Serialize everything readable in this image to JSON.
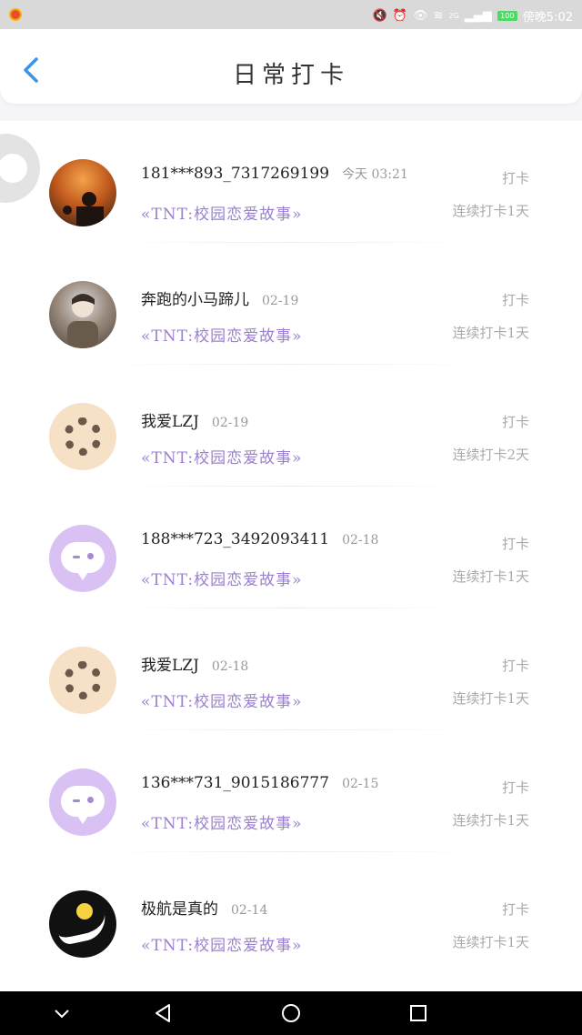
{
  "status_bar": {
    "time": "傍晚5:02",
    "network": "2G",
    "battery": "100"
  },
  "header": {
    "title": "日常打卡"
  },
  "list": {
    "items": [
      {
        "name": "181***893_7317269199",
        "date": "今天 03:21",
        "story": "«TNT:校园恋爱故事»",
        "action": "打卡",
        "streak": "连续打卡1天",
        "avatar": "sunset-photo"
      },
      {
        "name": "奔跑的小马蹄儿",
        "date": "02-19",
        "story": "«TNT:校园恋爱故事»",
        "action": "打卡",
        "streak": "连续打卡1天",
        "avatar": "person-photo"
      },
      {
        "name": "我爱LZJ",
        "date": "02-19",
        "story": "«TNT:校园恋爱故事»",
        "action": "打卡",
        "streak": "连续打卡2天",
        "avatar": "cartoon-group"
      },
      {
        "name": "188***723_3492093411",
        "date": "02-18",
        "story": "«TNT:校园恋爱故事»",
        "action": "打卡",
        "streak": "连续打卡1天",
        "avatar": "default-bot"
      },
      {
        "name": "我爱LZJ",
        "date": "02-18",
        "story": "«TNT:校园恋爱故事»",
        "action": "打卡",
        "streak": "连续打卡1天",
        "avatar": "cartoon-group"
      },
      {
        "name": "136***731_9015186777",
        "date": "02-15",
        "story": "«TNT:校园恋爱故事»",
        "action": "打卡",
        "streak": "连续打卡1天",
        "avatar": "default-bot"
      },
      {
        "name": "极航是真的",
        "date": "02-14",
        "story": "«TNT:校园恋爱故事»",
        "action": "打卡",
        "streak": "连续打卡1天",
        "avatar": "black-logo"
      }
    ]
  },
  "colors": {
    "accent_blue": "#3a95e8",
    "story_purple": "#9b7fd0",
    "muted_gray": "#aaaaaa",
    "bot_avatar_bg": "#d9c2f3"
  }
}
